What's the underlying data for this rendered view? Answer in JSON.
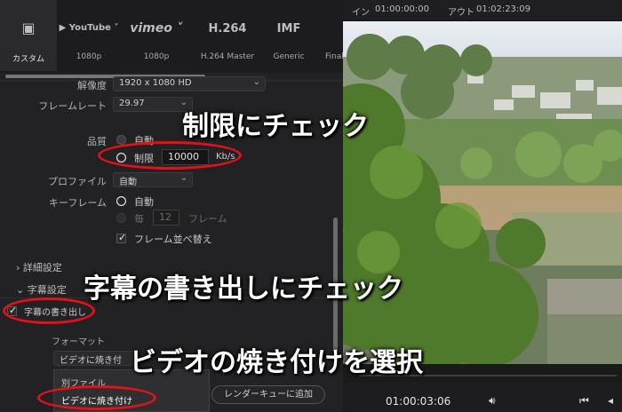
{
  "presets": [
    {
      "logo": "▣",
      "label": "カスタム"
    },
    {
      "logo": "▶ YouTube ˅",
      "label": "1080p"
    },
    {
      "logo": "vimeo ˅",
      "label": "1080p"
    },
    {
      "logo": "H.264",
      "label": "H.264 Master"
    },
    {
      "logo": "IMF",
      "label": "Generic"
    },
    {
      "logo": "",
      "label": "Final"
    }
  ],
  "settings": {
    "resolution_label": "解像度",
    "resolution_value": "1920 x 1080 HD",
    "framerate_label": "フレームレート",
    "framerate_value": "29.97",
    "quality_label": "品質",
    "quality_auto": "自動",
    "quality_limit": "制限",
    "quality_limit_value": "10000",
    "quality_unit": "Kb/s",
    "profile_label": "プロファイル",
    "profile_value": "自動",
    "keyframe_label": "キーフレーム",
    "keyframe_auto": "自動",
    "keyframe_every": "毎",
    "keyframe_every_value": "12",
    "keyframe_unit": "フレーム",
    "frame_reorder": "フレーム並べ替え"
  },
  "sections": {
    "advanced": "詳細設定",
    "subtitles": "字幕設定",
    "export_subtitles": "字幕の書き出し",
    "format_label": "フォーマット",
    "format_value": "ビデオに焼き付け"
  },
  "dropdown_options": [
    "別ファイル",
    "ビデオに焼き付け"
  ],
  "render_queue_button": "レンダーキューに追加",
  "viewer": {
    "in_label": "イン",
    "in_tc": "01:00:00:00",
    "out_label": "アウト",
    "out_tc": "01:02:23:09",
    "current_tc": "01:00:03:06"
  },
  "annotations": {
    "limit": "制限にチェック",
    "subtitles": "字幕の書き出しにチェック",
    "burn_in": "ビデオの焼き付けを選択"
  },
  "colors": {
    "annotation_ring": "#e1121b",
    "annotation_text": "#ffffff"
  }
}
